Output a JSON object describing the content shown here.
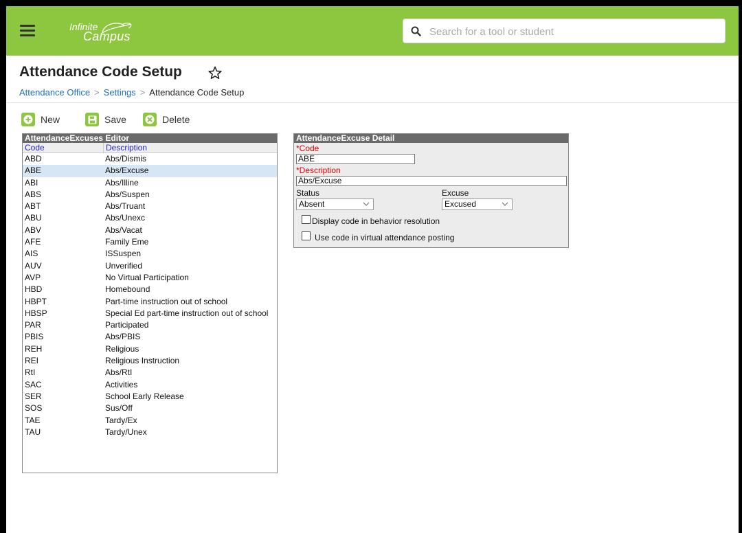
{
  "app": {
    "logo_line1": "Infinite",
    "logo_line2": "Campus",
    "search_placeholder": "Search for a tool or student",
    "brand_color": "#8dc63f"
  },
  "page": {
    "title": "Attendance Code Setup",
    "breadcrumb": [
      "Attendance Office",
      "Settings",
      "Attendance Code Setup"
    ]
  },
  "toolbar": {
    "new_label": "New",
    "save_label": "Save",
    "delete_label": "Delete"
  },
  "editor": {
    "title": "AttendanceExcuses Editor",
    "col_code": "Code",
    "col_description": "Description",
    "selected_code": "ABE",
    "rows": [
      {
        "code": "ABD",
        "description": "Abs/Dismis"
      },
      {
        "code": "ABE",
        "description": "Abs/Excuse"
      },
      {
        "code": "ABI",
        "description": "Abs/Illine"
      },
      {
        "code": "ABS",
        "description": "Abs/Suspen"
      },
      {
        "code": "ABT",
        "description": "Abs/Truant"
      },
      {
        "code": "ABU",
        "description": "Abs/Unexc"
      },
      {
        "code": "ABV",
        "description": "Abs/Vacat"
      },
      {
        "code": "AFE",
        "description": "Family Eme"
      },
      {
        "code": "AIS",
        "description": "ISSuspen"
      },
      {
        "code": "AUV",
        "description": "Unverified"
      },
      {
        "code": "AVP",
        "description": "No Virtual Participation"
      },
      {
        "code": "HBD",
        "description": "Homebound"
      },
      {
        "code": "HBPT",
        "description": "Part-time instruction out of school"
      },
      {
        "code": "HBSP",
        "description": "Special Ed part-time instruction out of school"
      },
      {
        "code": "PAR",
        "description": "Participated"
      },
      {
        "code": "PBIS",
        "description": "Abs/PBIS"
      },
      {
        "code": "REH",
        "description": "Religious"
      },
      {
        "code": "REI",
        "description": "Religious Instruction"
      },
      {
        "code": "RtI",
        "description": "Abs/RtI"
      },
      {
        "code": "SAC",
        "description": "Activities"
      },
      {
        "code": "SER",
        "description": "School Early Release"
      },
      {
        "code": "SOS",
        "description": "Sus/Off"
      },
      {
        "code": "TAE",
        "description": "Tardy/Ex"
      },
      {
        "code": "TAU",
        "description": "Tardy/Unex"
      }
    ]
  },
  "detail": {
    "title": "AttendanceExcuse Detail",
    "code_label": "*Code",
    "code_value": "ABE",
    "description_label": "*Description",
    "description_value": "Abs/Excuse",
    "status_label": "Status",
    "status_value": "Absent",
    "excuse_label": "Excuse",
    "excuse_value": "Excused",
    "behavior_label": "Display code in behavior resolution",
    "behavior_checked": false,
    "virtual_label": "Use code in virtual attendance posting",
    "virtual_checked": false
  }
}
